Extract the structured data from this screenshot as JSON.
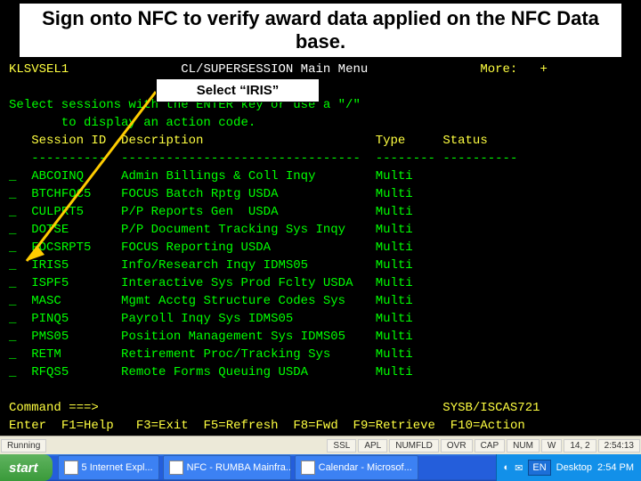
{
  "banner": "Sign onto NFC to verify award data applied on the NFC Data base.",
  "callout": "Select “IRIS”",
  "header": {
    "left": "KLSVSEL1",
    "center": "CL/SUPERSESSION Main Menu",
    "right": "More:   +"
  },
  "instructions": {
    "line1": "Select sessions with the ENTER key or use a \"/\"",
    "line2": "       to display an action code."
  },
  "columns": {
    "session": "Session ID",
    "desc": "Description",
    "type": "Type",
    "status": "Status"
  },
  "rules": {
    "session": "----------",
    "desc": "--------------------------------",
    "type": "--------",
    "status": "----------"
  },
  "rows": [
    {
      "id": "ABCOINQ",
      "desc": "Admin Billings & Coll Inqy",
      "type": "Multi"
    },
    {
      "id": "BTCHFOC5",
      "desc": "FOCUS Batch Rptg USDA",
      "type": "Multi"
    },
    {
      "id": "CULPRT5",
      "desc": "P/P Reports Gen  USDA",
      "type": "Multi"
    },
    {
      "id": "DOTSE",
      "desc": "P/P Document Tracking Sys Inqy",
      "type": "Multi"
    },
    {
      "id": "FOCSRPT5",
      "desc": "FOCUS Reporting USDA",
      "type": "Multi"
    },
    {
      "id": "IRIS5",
      "desc": "Info/Research Inqy IDMS05",
      "type": "Multi"
    },
    {
      "id": "ISPF5",
      "desc": "Interactive Sys Prod Fclty USDA",
      "type": "Multi"
    },
    {
      "id": "MASC",
      "desc": "Mgmt Acctg Structure Codes Sys",
      "type": "Multi"
    },
    {
      "id": "PINQ5",
      "desc": "Payroll Inqy Sys IDMS05",
      "type": "Multi"
    },
    {
      "id": "PMS05",
      "desc": "Position Management Sys IDMS05",
      "type": "Multi"
    },
    {
      "id": "RETM",
      "desc": "Retirement Proc/Tracking Sys",
      "type": "Multi"
    },
    {
      "id": "RFQS5",
      "desc": "Remote Forms Queuing USDA",
      "type": "Multi"
    }
  ],
  "command": {
    "prompt": "Command ===>",
    "sysid": "SYSB/ISCAS721"
  },
  "fkeys": {
    "enter": "Enter",
    "f1": "F1=Help",
    "f3": "F3=Exit",
    "f5": "F5=Refresh",
    "f8": "F8=Fwd",
    "f9": "F9=Retrieve",
    "f10": "F10=Action"
  },
  "statusbar": {
    "left": "Running",
    "cells": [
      "SSL",
      "APL",
      "NUMFLD",
      "OVR",
      "CAP",
      "NUM",
      "W",
      "14, 2",
      "2:54:13"
    ]
  },
  "taskbar": {
    "start": "start",
    "items": [
      "5 Internet Expl...",
      "NFC - RUMBA Mainfra...",
      "Calendar - Microsof..."
    ],
    "tray": {
      "desktop": "Desktop",
      "clock": "2:54 PM"
    }
  }
}
